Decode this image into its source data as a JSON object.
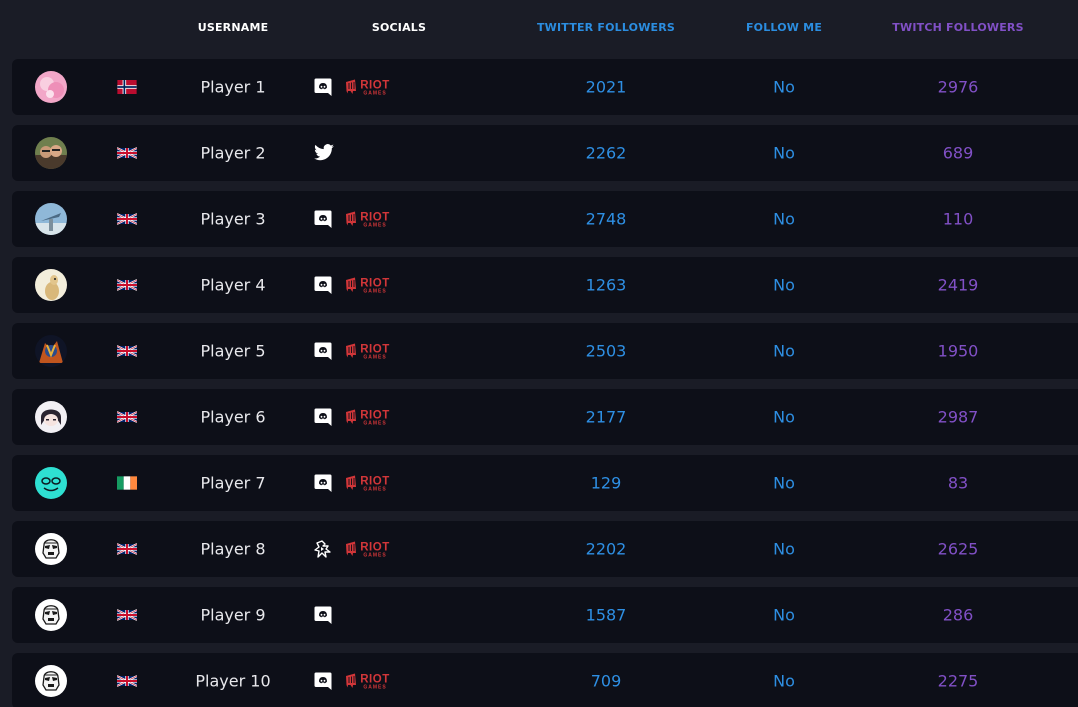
{
  "header": {
    "username": "USERNAME",
    "socials": "SOCIALS",
    "twitter_followers": "TWITTER FOLLOWERS",
    "follow_me": "FOLLOW ME",
    "twitch_followers": "TWITCH FOLLOWERS"
  },
  "colors": {
    "background": "#1a1c26",
    "row": "#0d0f18",
    "twitter_blue": "#2e8fe3",
    "twitch_purple": "#8150c6",
    "riot_red": "#d13639"
  },
  "riot_logo": {
    "word": "RIOT",
    "sub": "GAMES"
  },
  "players": [
    {
      "name": "Player 1",
      "flag": "norway-flag",
      "avatar": "pink-avatar",
      "socials": [
        "discord-icon",
        "riot-games-logo"
      ],
      "twitter": "2021",
      "follow": "No",
      "twitch": "2976"
    },
    {
      "name": "Player 2",
      "flag": "uk-flag",
      "avatar": "photo-avatar",
      "socials": [
        "twitter-icon"
      ],
      "twitter": "2262",
      "follow": "No",
      "twitch": "689"
    },
    {
      "name": "Player 3",
      "flag": "uk-flag",
      "avatar": "sky-avatar",
      "socials": [
        "discord-icon",
        "riot-games-logo"
      ],
      "twitter": "2748",
      "follow": "No",
      "twitch": "110"
    },
    {
      "name": "Player 4",
      "flag": "uk-flag",
      "avatar": "cream-avatar",
      "socials": [
        "discord-icon",
        "riot-games-logo"
      ],
      "twitter": "1263",
      "follow": "No",
      "twitch": "2419"
    },
    {
      "name": "Player 5",
      "flag": "uk-flag",
      "avatar": "hero-avatar",
      "socials": [
        "discord-icon",
        "riot-games-logo"
      ],
      "twitter": "2503",
      "follow": "No",
      "twitch": "1950"
    },
    {
      "name": "Player 6",
      "flag": "uk-flag",
      "avatar": "anime-avatar",
      "socials": [
        "discord-icon",
        "riot-games-logo"
      ],
      "twitter": "2177",
      "follow": "No",
      "twitch": "2987"
    },
    {
      "name": "Player 7",
      "flag": "ireland-flag",
      "avatar": "teal-face-avatar",
      "socials": [
        "discord-icon",
        "riot-games-logo"
      ],
      "twitter": "129",
      "follow": "No",
      "twitch": "83"
    },
    {
      "name": "Player 8",
      "flag": "uk-flag",
      "avatar": "stormtrooper-avatar",
      "socials": [
        "fortnite-icon",
        "riot-games-logo"
      ],
      "twitter": "2202",
      "follow": "No",
      "twitch": "2625"
    },
    {
      "name": "Player 9",
      "flag": "uk-flag",
      "avatar": "stormtrooper-avatar",
      "socials": [
        "discord-icon"
      ],
      "twitter": "1587",
      "follow": "No",
      "twitch": "286"
    },
    {
      "name": "Player 10",
      "flag": "uk-flag",
      "avatar": "stormtrooper-avatar",
      "socials": [
        "discord-icon",
        "riot-games-logo"
      ],
      "twitter": "709",
      "follow": "No",
      "twitch": "2275"
    }
  ]
}
